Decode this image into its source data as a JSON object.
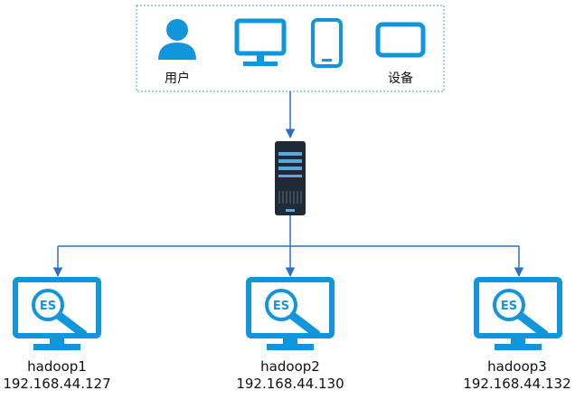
{
  "clients": {
    "user_label": "用户",
    "device_label": "设备"
  },
  "nodes": [
    {
      "name": "hadoop1",
      "ip": "192.168.44.127",
      "logo_text": "ES"
    },
    {
      "name": "hadoop2",
      "ip": "192.168.44.130",
      "logo_text": "ES"
    },
    {
      "name": "hadoop3",
      "ip": "192.168.44.132",
      "logo_text": "ES"
    }
  ],
  "colors": {
    "accent": "#1296db",
    "box_border": "#3aa0c8",
    "arrow": "#2f6fc4",
    "server": "#1f2a36",
    "server_stripe": "#5aa8d6",
    "logo_ring": "#1296db"
  },
  "icons": [
    "user-icon",
    "monitor-icon",
    "phone-icon",
    "tablet-icon",
    "server-icon",
    "es-monitor-icon"
  ]
}
